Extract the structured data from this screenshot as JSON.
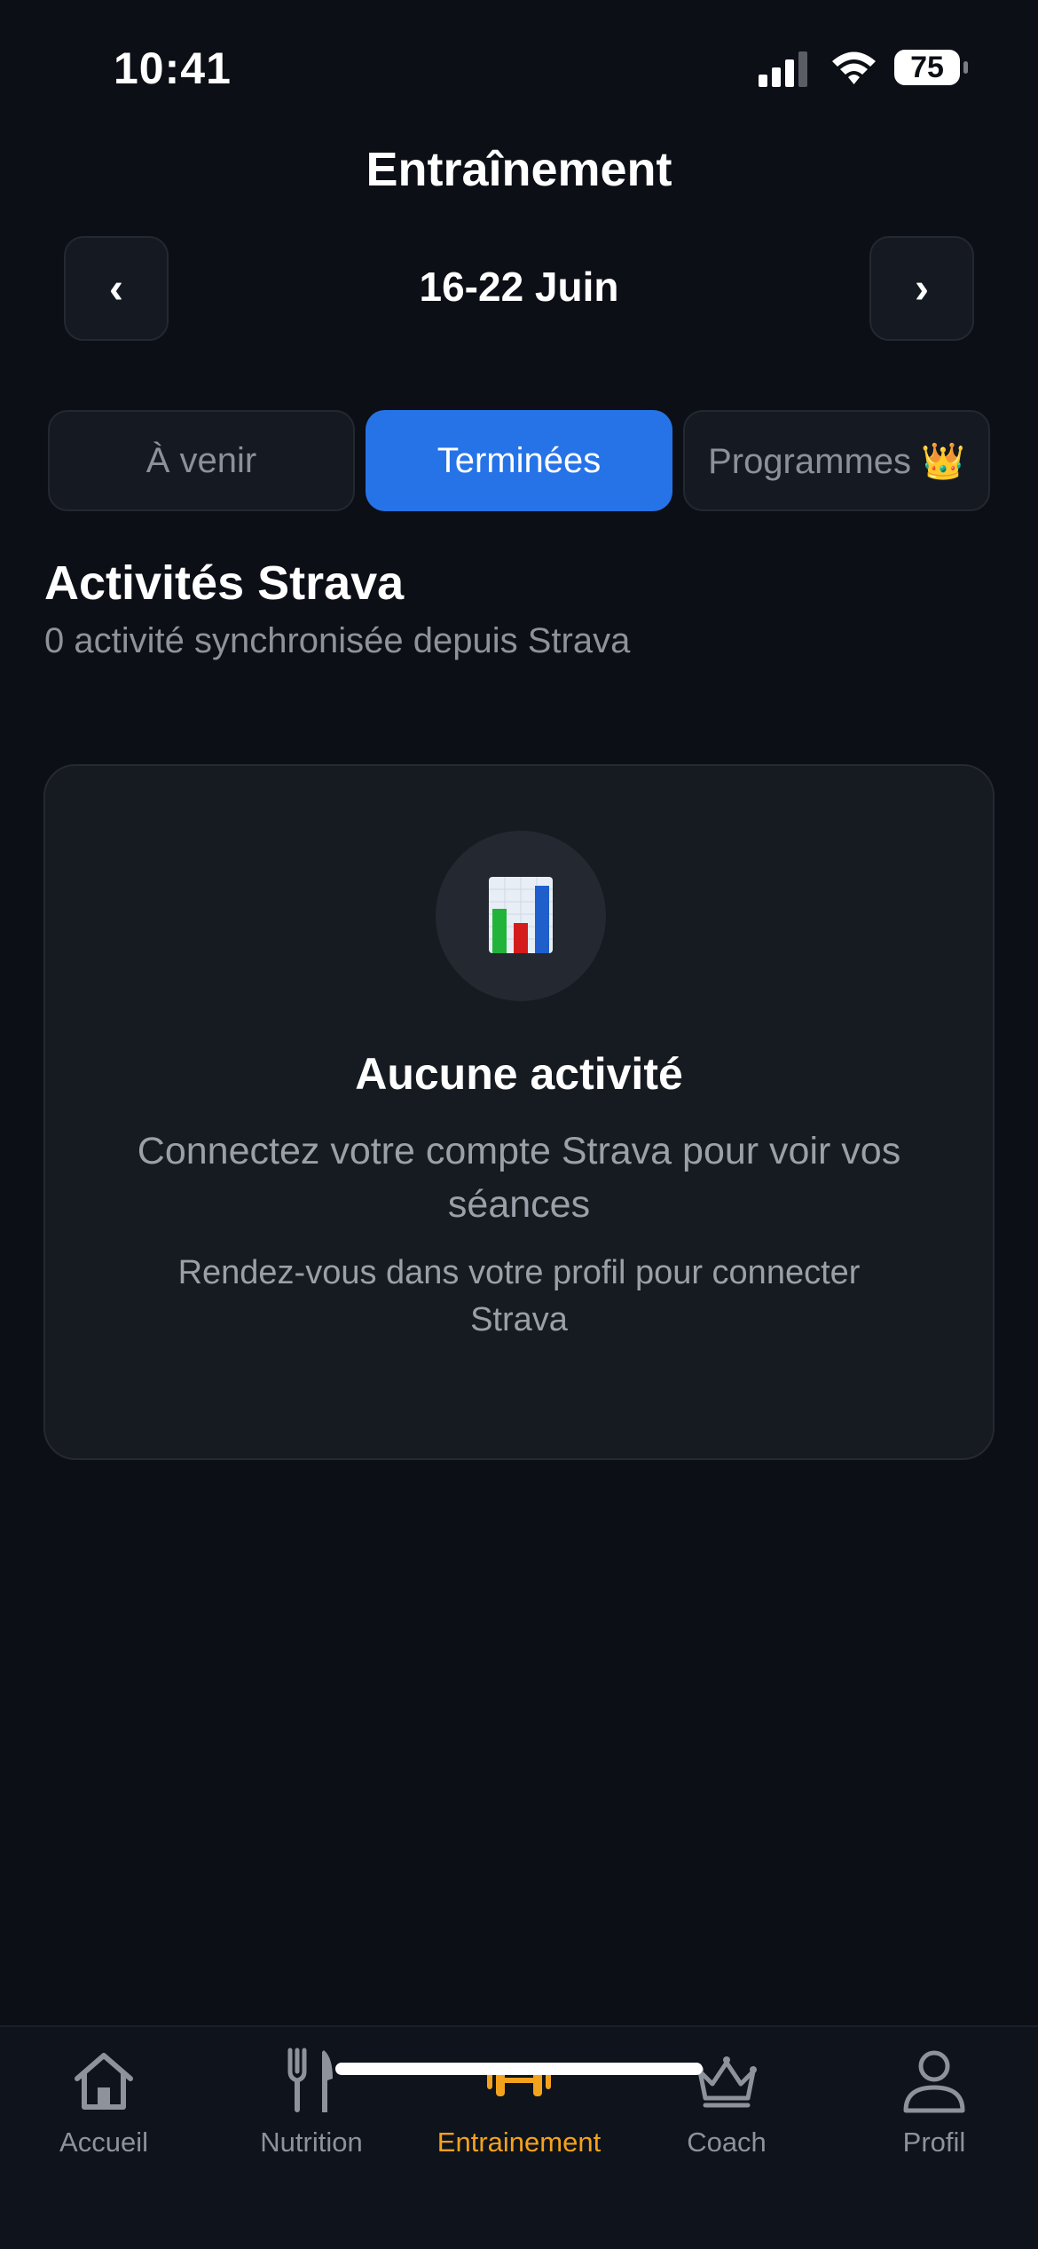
{
  "status_bar": {
    "time": "10:41",
    "battery": "75"
  },
  "header": {
    "title": "Entraînement",
    "week_label": "16-22 Juin",
    "prev_label": "‹",
    "next_label": "›"
  },
  "tabs": [
    {
      "label": "À venir",
      "active": false
    },
    {
      "label": "Terminées",
      "active": true
    },
    {
      "label": "Programmes 👑",
      "active": false
    }
  ],
  "section": {
    "title": "Activités Strava",
    "subtitle": "0 activité synchronisée depuis Strava"
  },
  "empty_state": {
    "icon": "bar-chart-icon",
    "title": "Aucune activité",
    "message": "Connectez votre compte Strava pour voir vos séances",
    "hint": "Rendez-vous dans votre profil pour connecter Strava"
  },
  "tab_bar": {
    "items": [
      {
        "label": "Accueil",
        "icon": "home-icon",
        "active": false
      },
      {
        "label": "Nutrition",
        "icon": "fork-knife-icon",
        "active": false
      },
      {
        "label": "Entrainement",
        "icon": "dumbbell-icon",
        "active": true
      },
      {
        "label": "Coach",
        "icon": "crown-icon",
        "active": false
      },
      {
        "label": "Profil",
        "icon": "person-icon",
        "active": false
      }
    ]
  },
  "colors": {
    "background": "#0c0f16",
    "accent_blue": "#2673e8",
    "accent_orange": "#f3a21d",
    "muted_text": "#8d929b"
  }
}
